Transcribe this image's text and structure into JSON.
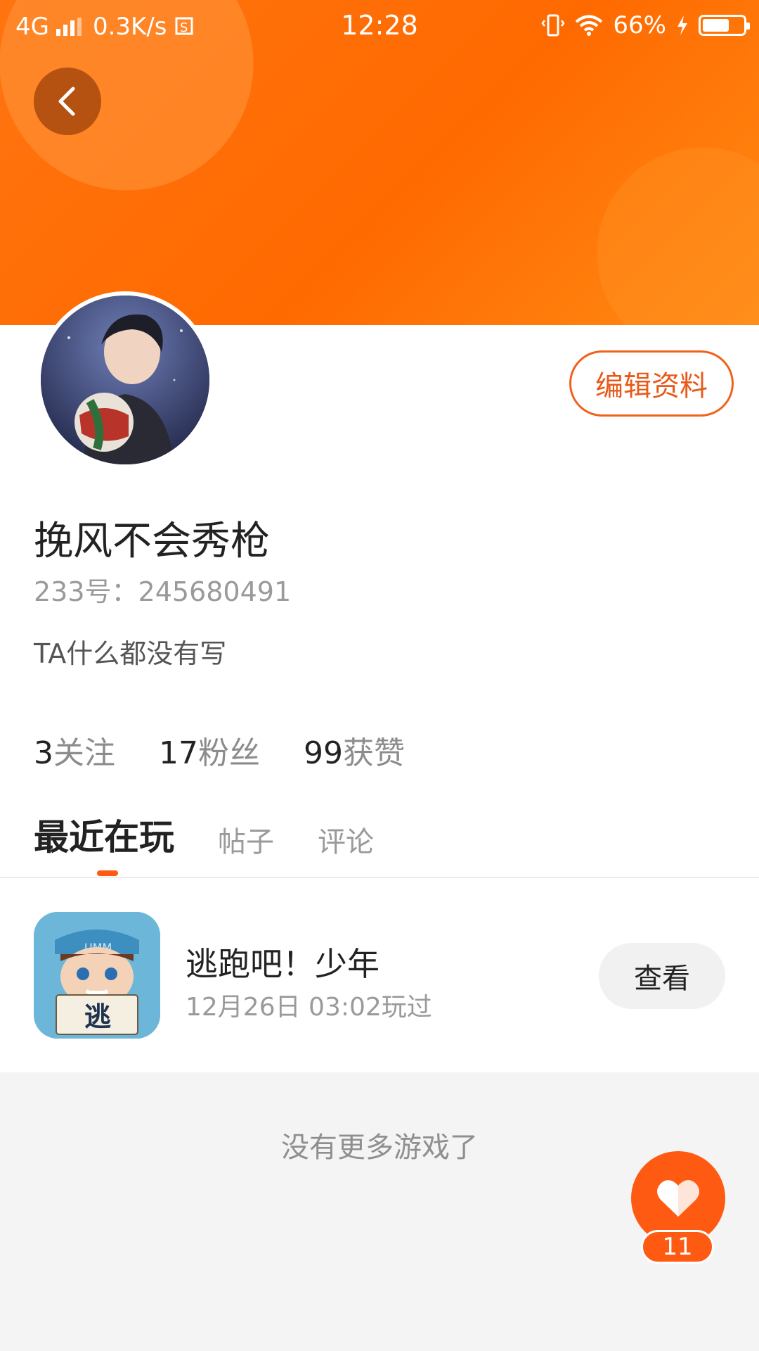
{
  "status_bar": {
    "network": "4G",
    "speed": "0.3K/s",
    "time": "12:28",
    "battery": "66%",
    "battery_level": 0.66
  },
  "header": {
    "back_icon": "chevron-left-icon"
  },
  "profile": {
    "nickname": "挽风不会秀枪",
    "uid_label": "233号：245680491",
    "bio": "TA什么都没有写",
    "edit_label": "编辑资料"
  },
  "stats": {
    "following_num": "3",
    "following_label": "关注",
    "fans_num": "17",
    "fans_label": "粉丝",
    "likes_num": "99",
    "likes_label": "获赞"
  },
  "tabs": [
    {
      "label": "最近在玩",
      "active": true
    },
    {
      "label": "帖子",
      "active": false
    },
    {
      "label": "评论",
      "active": false
    }
  ],
  "recent_games": [
    {
      "name": "逃跑吧！少年",
      "played_time": "12月26日 03:02玩过",
      "icon_text": "逃",
      "action_label": "查看"
    }
  ],
  "footer": {
    "no_more_text": "没有更多游戏了"
  },
  "like_fab": {
    "icon": "heart-icon",
    "count": "11"
  },
  "colors": {
    "accent": "#ff5a12",
    "banner": "#ff6a00"
  }
}
